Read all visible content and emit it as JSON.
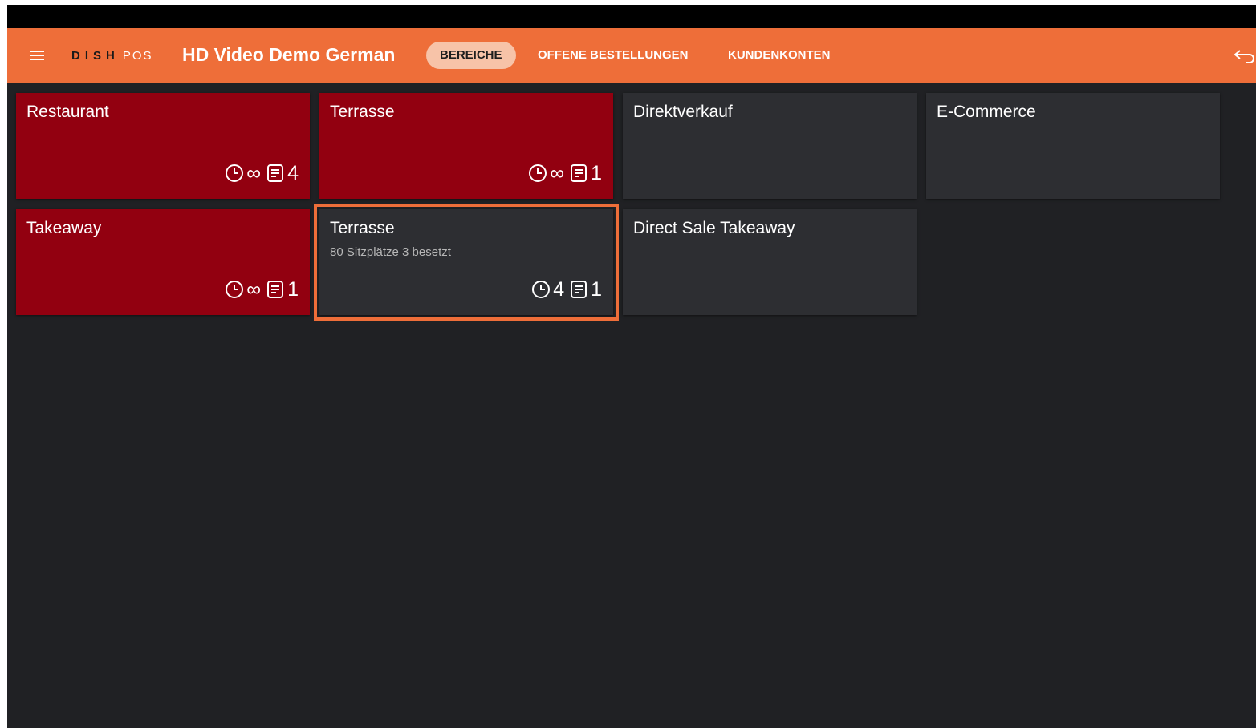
{
  "app": {
    "logo_brand": "DISH",
    "logo_suffix": "POS",
    "title": "HD Video Demo German"
  },
  "colors": {
    "accent": "#ee6e39",
    "area_active": "#920010",
    "area_idle": "#2d2e32",
    "background": "#202124"
  },
  "nav": {
    "tabs": [
      {
        "label": "BEREICHE",
        "active": true
      },
      {
        "label": "OFFENE BESTELLUNGEN",
        "active": false
      },
      {
        "label": "KUNDENKONTEN",
        "active": false
      }
    ]
  },
  "icons": {
    "menu": "hamburger-menu-icon",
    "back": "back-arrow-icon",
    "time": "clock-icon",
    "orders": "receipt-icon"
  },
  "areas": [
    {
      "name": "Restaurant",
      "subtitle": "",
      "time": "∞",
      "orders": "4",
      "state": "active"
    },
    {
      "name": "Terrasse",
      "subtitle": "",
      "time": "∞",
      "orders": "1",
      "state": "active"
    },
    {
      "name": "Direktverkauf",
      "subtitle": "",
      "time": "",
      "orders": "",
      "state": "idle"
    },
    {
      "name": "E-Commerce",
      "subtitle": "",
      "time": "",
      "orders": "",
      "state": "idle"
    },
    {
      "name": "Takeaway",
      "subtitle": "",
      "time": "∞",
      "orders": "1",
      "state": "active"
    },
    {
      "name": "Terrasse",
      "subtitle": "80 Sitzplätze 3 besetzt",
      "time": "4",
      "orders": "1",
      "state": "selected"
    },
    {
      "name": "Direct Sale Takeaway",
      "subtitle": "",
      "time": "",
      "orders": "",
      "state": "idle"
    }
  ]
}
